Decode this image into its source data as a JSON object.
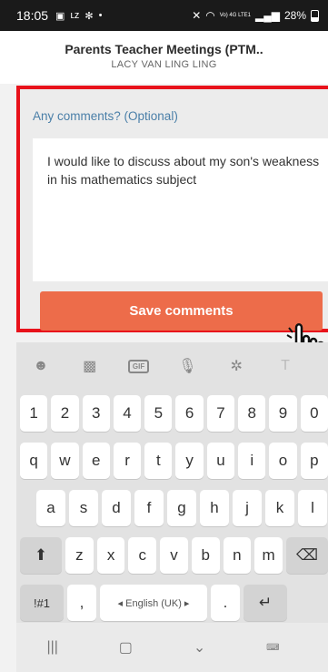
{
  "status": {
    "time": "18:05",
    "left_icons": [
      "gallery-icon",
      "lazada-icon",
      "bluetooth-icon",
      "dot-icon"
    ],
    "right_text": "Vo) 4G LTE1",
    "battery": "28%"
  },
  "header": {
    "title": "Parents Teacher Meetings (PTM..",
    "subtitle": "LACY VAN LING LING"
  },
  "comments": {
    "label": "Any comments? (Optional)",
    "value": "I would like to discuss about my son's weakness in his mathematics subject",
    "save_label": "Save comments"
  },
  "keyboard": {
    "toolbar": [
      "emoji-icon",
      "sticker-icon",
      "gif-icon",
      "mic-icon",
      "settings-icon",
      "text-icon"
    ],
    "gif_label": "GIF",
    "number_row": [
      "1",
      "2",
      "3",
      "4",
      "5",
      "6",
      "7",
      "8",
      "9",
      "0"
    ],
    "row1": [
      "q",
      "w",
      "e",
      "r",
      "t",
      "y",
      "u",
      "i",
      "o",
      "p"
    ],
    "row2": [
      "a",
      "s",
      "d",
      "f",
      "g",
      "h",
      "j",
      "k",
      "l"
    ],
    "row3": [
      "z",
      "x",
      "c",
      "v",
      "b",
      "n",
      "m"
    ],
    "symbols_label": "!#1",
    "comma": ",",
    "space_label": "◂ English (UK) ▸",
    "period": "."
  },
  "navbar": [
    "recent-apps-icon",
    "home-icon",
    "back-icon",
    "keyboard-switch-icon"
  ],
  "colors": {
    "highlight": "#e8121b",
    "save_button": "#ed6c4a",
    "label": "#4a7fa8"
  }
}
